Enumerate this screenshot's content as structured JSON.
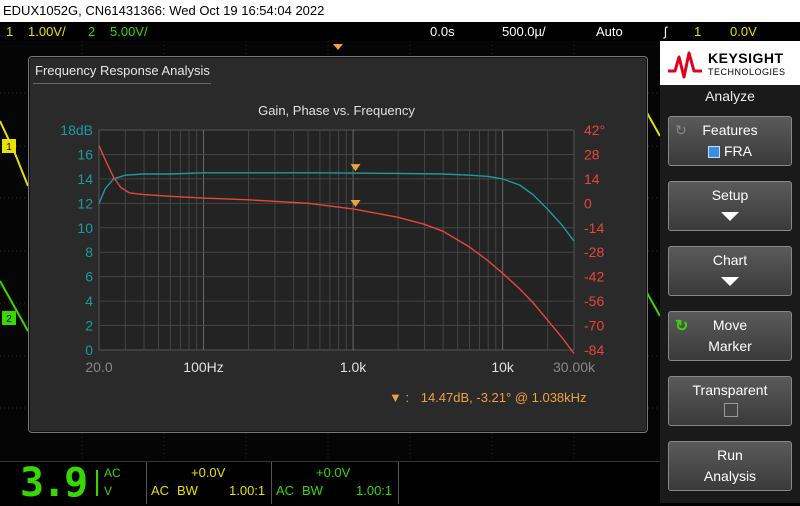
{
  "titlebar": {
    "text": "EDUX1052G, CN61431366: Wed Oct 19 16:54:04 2022"
  },
  "status": {
    "ch1_num": "1",
    "ch1_scale": "1.00V/",
    "ch2_num": "2",
    "ch2_scale": "5.00V/",
    "time_offset": "0.0s",
    "time_scale": "500.0µ/",
    "trigger_mode": "Auto",
    "trigger_icon": "ʃ",
    "trigger_ch": "1",
    "trigger_level": "0.0V"
  },
  "fra": {
    "window_title": "Frequency Response Analysis",
    "marker_readout": "14.47dB, -3.21° @ 1.038kHz",
    "marker_symbol": "▼ :"
  },
  "chart_data": {
    "type": "line",
    "title": "Gain, Phase vs. Frequency",
    "x_scale": "log",
    "xlim": [
      20,
      30000
    ],
    "x_ticks": [
      "20.0",
      "100Hz",
      "1.0k",
      "10k",
      "30.00k"
    ],
    "y_left_ticks": [
      "18dB",
      "16",
      "14",
      "12",
      "10",
      "8",
      "6",
      "4",
      "2",
      "0"
    ],
    "y_right_ticks": [
      "42°",
      "28",
      "14",
      "0",
      "-14",
      "-28",
      "-42",
      "-56",
      "-70",
      "-84"
    ],
    "ylim_left": [
      0,
      18
    ],
    "ylim_right": [
      -84,
      42
    ],
    "series": [
      {
        "name": "Gain",
        "axis": "left",
        "color": "#1e9aa0",
        "x": [
          20,
          22,
          25,
          30,
          40,
          60,
          100,
          200,
          500,
          1000,
          2000,
          4000,
          6000,
          8000,
          10000,
          13000,
          16000,
          20000,
          25000,
          30000
        ],
        "y": [
          12.0,
          13.2,
          14.0,
          14.3,
          14.4,
          14.4,
          14.5,
          14.5,
          14.5,
          14.47,
          14.45,
          14.4,
          14.3,
          14.2,
          14.0,
          13.5,
          12.7,
          11.5,
          10.2,
          8.9
        ]
      },
      {
        "name": "Phase",
        "axis": "right",
        "color": "#e8453c",
        "x": [
          20,
          22,
          25,
          28,
          32,
          40,
          60,
          100,
          200,
          500,
          1000,
          2000,
          3000,
          4000,
          6000,
          8000,
          10000,
          13000,
          16000,
          20000,
          25000,
          30000
        ],
        "y": [
          33,
          25,
          15,
          9,
          6,
          5,
          4,
          3,
          2,
          0,
          -3.21,
          -8,
          -12,
          -16,
          -25,
          -33,
          -40,
          -49,
          -57,
          -67,
          -77,
          -86
        ]
      }
    ],
    "markers": [
      {
        "axis": "left",
        "x": 1038,
        "y": 14.47
      },
      {
        "axis": "right",
        "x": 1038,
        "y": -3.21
      }
    ]
  },
  "bottom": {
    "ch1_big": "3.9",
    "ch1_ac": "AC",
    "ch1_unit": "V",
    "ch1_offset": "+0.0V",
    "ch1_coupling": "AC",
    "ch1_bw": "BW",
    "ch1_probe": "1.00:1",
    "ch2_offset": "+0.0V",
    "ch2_coupling": "AC",
    "ch2_bw": "BW",
    "ch2_probe": "1.00:1"
  },
  "panel": {
    "brand": "KEYSIGHT",
    "brand_sub": "TECHNOLOGIES",
    "title": "Analyze",
    "features_label": "Features",
    "features_value": "FRA",
    "setup_label": "Setup",
    "chart_label": "Chart",
    "move_marker_l1": "Move",
    "move_marker_l2": "Marker",
    "transparent_label": "Transparent",
    "run_l1": "Run",
    "run_l2": "Analysis"
  },
  "colors": {
    "ch1": "#e8e000",
    "ch2": "#36d800",
    "gain": "#1e9aa0",
    "phase": "#e8453c",
    "marker": "#f0a040"
  }
}
